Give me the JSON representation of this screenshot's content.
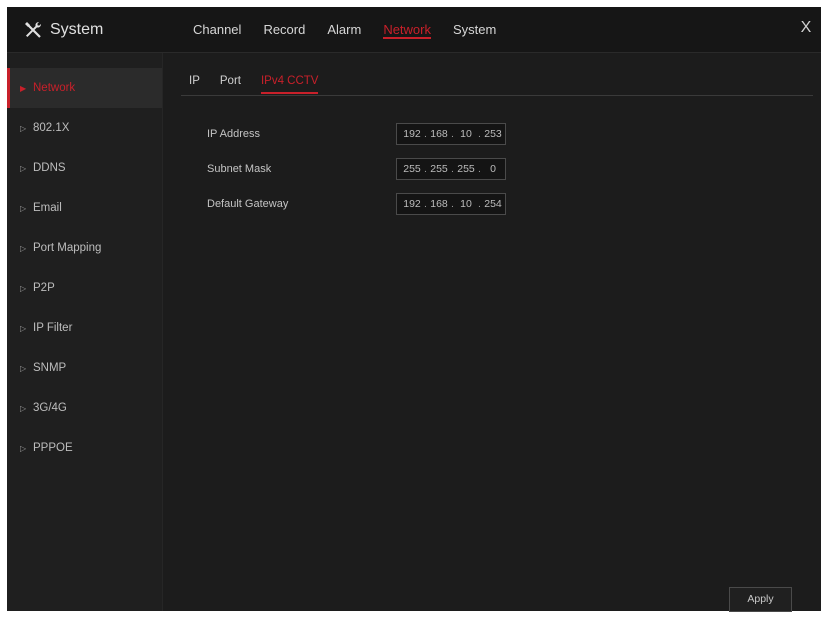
{
  "app": {
    "title": "System",
    "icon": "tools-icon",
    "close_label": "X"
  },
  "header": {
    "tabs": [
      {
        "label": "Channel",
        "active": false
      },
      {
        "label": "Record",
        "active": false
      },
      {
        "label": "Alarm",
        "active": false
      },
      {
        "label": "Network",
        "active": true
      },
      {
        "label": "System",
        "active": false
      }
    ]
  },
  "sidebar": {
    "items": [
      {
        "label": "Network",
        "active": true
      },
      {
        "label": "802.1X",
        "active": false
      },
      {
        "label": "DDNS",
        "active": false
      },
      {
        "label": "Email",
        "active": false
      },
      {
        "label": "Port Mapping",
        "active": false
      },
      {
        "label": "P2P",
        "active": false
      },
      {
        "label": "IP Filter",
        "active": false
      },
      {
        "label": "SNMP",
        "active": false
      },
      {
        "label": "3G/4G",
        "active": false
      },
      {
        "label": "PPPOE",
        "active": false
      }
    ]
  },
  "content": {
    "sub_tabs": [
      {
        "label": "IP",
        "active": false
      },
      {
        "label": "Port",
        "active": false
      },
      {
        "label": "IPv4 CCTV",
        "active": true
      }
    ],
    "fields": [
      {
        "label": "IP Address",
        "octets": [
          "192",
          "168",
          "10",
          "253"
        ]
      },
      {
        "label": "Subnet Mask",
        "octets": [
          "255",
          "255",
          "255",
          "0"
        ]
      },
      {
        "label": "Default Gateway",
        "octets": [
          "192",
          "168",
          "10",
          "254"
        ]
      }
    ],
    "apply_label": "Apply"
  },
  "colors": {
    "accent": "#c8202a",
    "background": "#1c1c1c",
    "sidebar": "#1f1f1f",
    "text": "#c9c9c9"
  }
}
